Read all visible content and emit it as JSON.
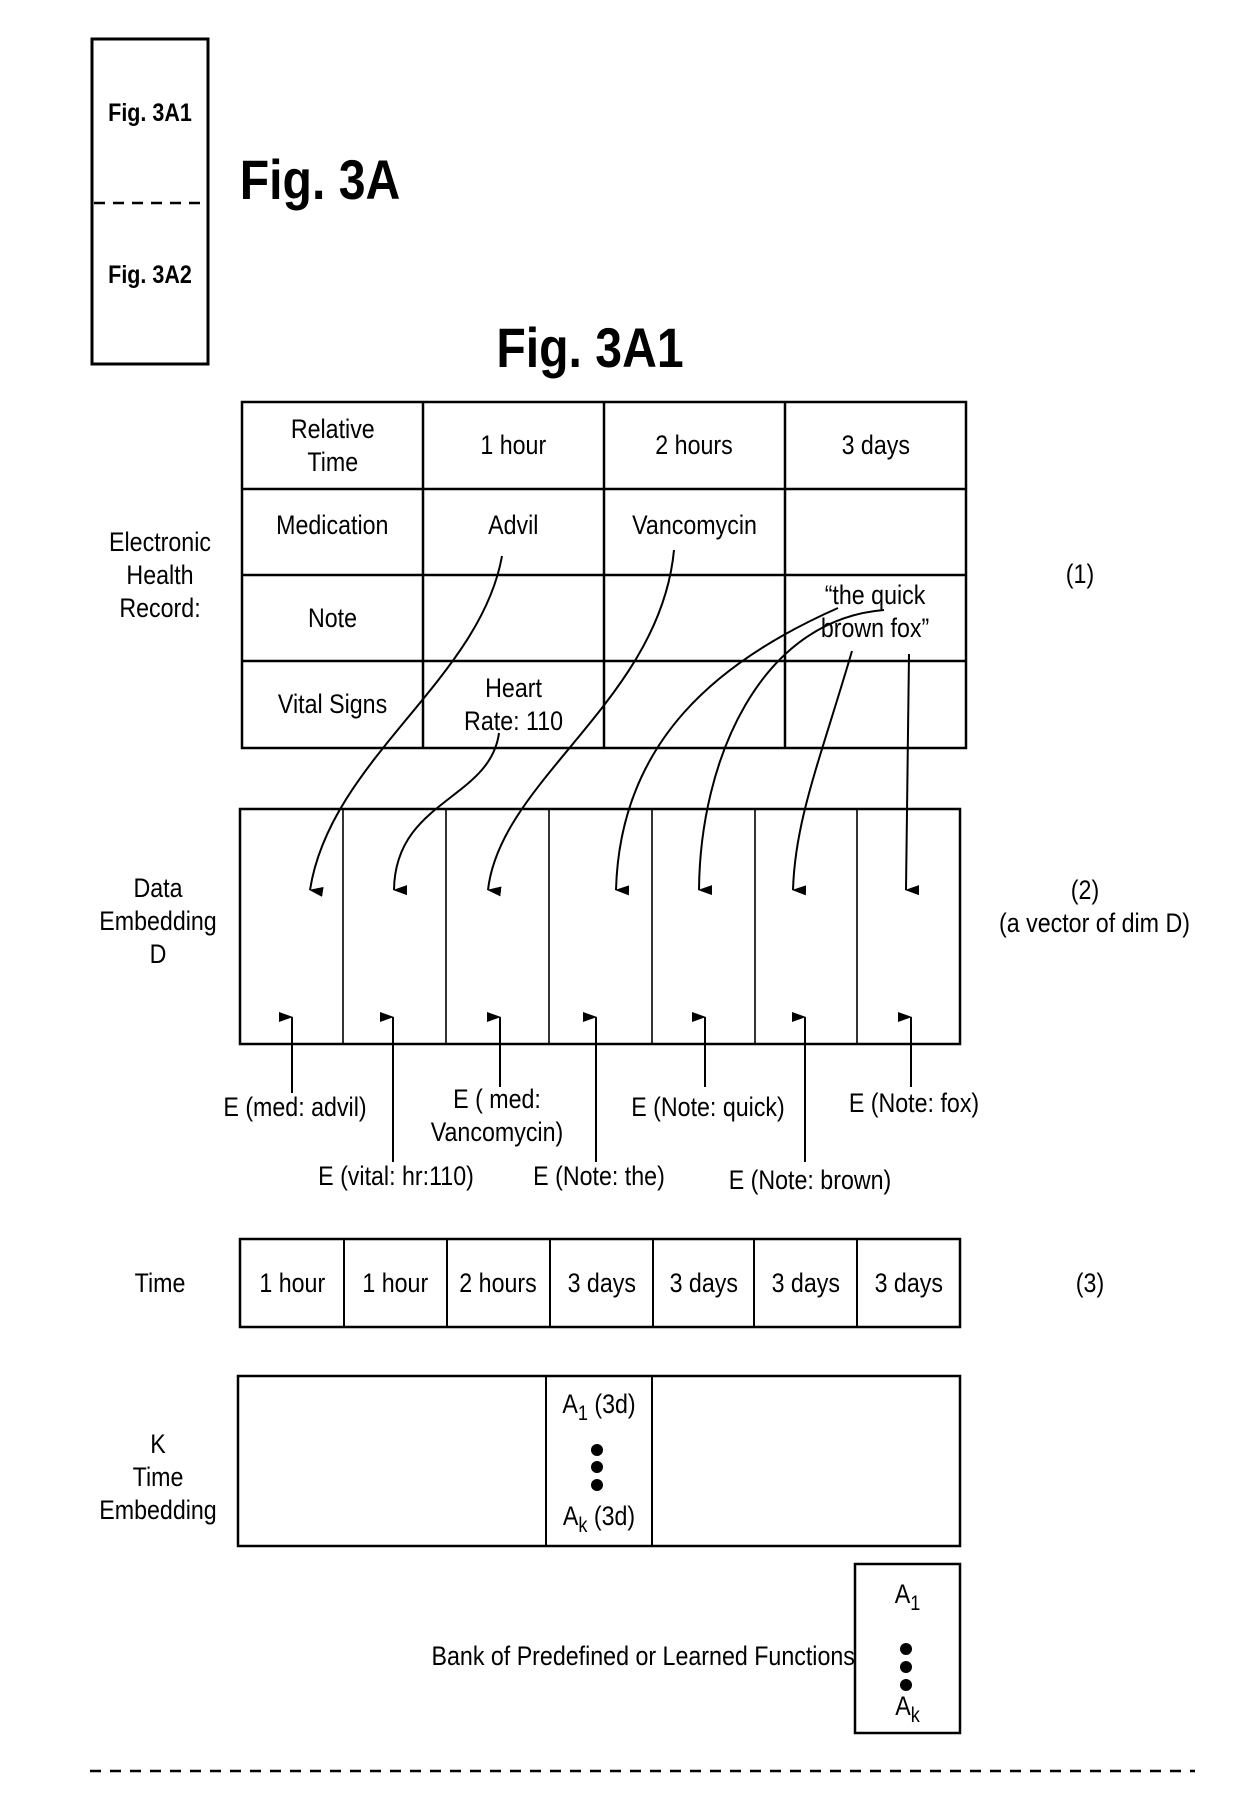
{
  "key_box": {
    "top_label": "Fig. 3A1",
    "bottom_label": "Fig. 3A2"
  },
  "figure_title": "Fig. 3A",
  "subfigure_title": "Fig. 3A1",
  "ehr": {
    "side_label_lines": [
      "Electronic",
      "Health",
      "Record:"
    ],
    "ref_number": "(1)",
    "rows": [
      {
        "header": [
          "Relative",
          "Time"
        ],
        "cells": [
          [
            "1 hour"
          ],
          [
            "2 hours"
          ],
          [
            "3 days"
          ]
        ]
      },
      {
        "header": [
          "Medication"
        ],
        "cells": [
          [
            "Advil"
          ],
          [
            "Vancomycin"
          ],
          []
        ]
      },
      {
        "header": [
          "Note"
        ],
        "cells": [
          [],
          [],
          [
            "“the quick",
            "brown fox”"
          ]
        ]
      },
      {
        "header": [
          "Vital Signs"
        ],
        "cells": [
          [
            "Heart",
            "Rate: 110"
          ],
          [],
          []
        ]
      }
    ]
  },
  "data_embedding": {
    "side_label_lines": [
      "Data",
      "Embedding",
      "D"
    ],
    "ref_number": "(2)",
    "ref_caption": "(a vector of dim D)",
    "slot_count": 7,
    "slot_sources": [
      "Advil",
      "Heart Rate: 110",
      "Vancomycin",
      "the",
      "quick",
      "brown",
      "fox"
    ],
    "labels": [
      [
        "E (med: advil)"
      ],
      [
        "E (vital: hr:110)"
      ],
      [
        "E ( med:",
        "Vancomycin)"
      ],
      [
        "E (Note: the)"
      ],
      [
        "E (Note: quick)"
      ],
      [
        "E (Note: brown)"
      ],
      [
        "E (Note: fox)"
      ]
    ]
  },
  "time_row": {
    "side_label": "Time",
    "ref_number": "(3)",
    "cells": [
      "1 hour",
      "1 hour",
      "2 hours",
      "3 days",
      "3 days",
      "3 days",
      "3 days"
    ]
  },
  "time_embedding": {
    "side_label_lines": [
      "K",
      "Time",
      "Embedding"
    ],
    "first_fn": {
      "base": "A",
      "sub": "1",
      "suffix": " (3d)"
    },
    "last_fn": {
      "base": "A",
      "sub": "k",
      "suffix": " (3d)"
    }
  },
  "function_bank": {
    "label": "Bank of Predefined or Learned Functions",
    "first_fn": {
      "base": "A",
      "sub": "1"
    },
    "last_fn": {
      "base": "A",
      "sub": "k"
    }
  }
}
